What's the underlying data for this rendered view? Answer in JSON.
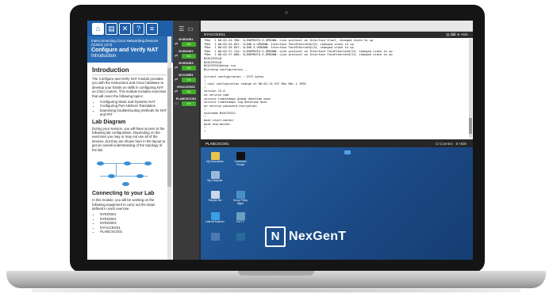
{
  "lab_panel": {
    "toolbar_icons": [
      "home-icon",
      "book-icon",
      "tools-icon",
      "help-icon",
      "document-icon"
    ],
    "course": "Interconnecting Cisco Networking Devices (ICND1 v3.0)",
    "lab_title": "Configure and Verify NAT",
    "lab_section": "Introduction",
    "intro_heading": "Introduction",
    "intro_text": "The Configure and Verify NAT module provides you with the instructions and Cisco hardware to develop your hands on skills in configuring NAT on Cisco routers. This module includes exercises that will cover the following topics:",
    "topics": [
      "Configuring Static and Dynamic NAT",
      "Configuring Port Address Translation",
      "Examining troubleshooting methods for NAT and PAT"
    ],
    "diagram_heading": "Lab Diagram",
    "diagram_text": "During your session, you will have access to the following lab configuration. Depending on the exercises you may or may not use all of the devices, but they are shown here in the layout to get an overall understanding of the topology of the lab.",
    "connect_heading": "Connecting to your Lab",
    "connect_text": "In this module, you will be working on the following equipment to carry out the steps defined in each exercise.",
    "equipment": [
      "NYEDGE1",
      "NYEDGE2",
      "NYEDGE3",
      "NYACCESS1",
      "PLABCSCO01"
    ]
  },
  "devices": [
    {
      "name": "NYEDGE1",
      "status": "On"
    },
    {
      "name": "NYEDGE2",
      "status": "On"
    },
    {
      "name": "NYEDGE3",
      "status": "On"
    },
    {
      "name": "NYCORE1",
      "status": "On"
    },
    {
      "name": "NYACCESS1",
      "status": "On"
    },
    {
      "name": "PLABCSCO01",
      "status": "On"
    }
  ],
  "terminal": {
    "title": "NYACCESS1",
    "hide_label": "Hide",
    "lines": [
      "*Mar  1 00:02:24.390: %LINEPROTO-5-UPDOWN: Line protocol on Interface Vlan1, changed state to up",
      "*Mar  1 00:02:25.857: %LINK-3-UPDOWN: Interface FastEthernet0/23, changed state to up",
      "*Mar  1 00:02:26.857: %LINK-3-UPDOWN: Interface FastEthernet0/24, changed state to up",
      "*Mar  1 00:02:27.134: %LINEPROTO-5-UPDOWN: Line protocol on Interface FastEthernet0/23, changed state to up",
      "*Mar  1 00:02:27.860: %LINEPROTO-5-UPDOWN: Line protocol on Interface FastEthernet0/24, changed state to up",
      "NYACCESS1#",
      "NYACCESS1#",
      "NYACCESS1#show run",
      "Building configuration...",
      "",
      "Current configuration : 1372 bytes",
      "!",
      "! Last configuration change at 00:01:14 UTC Mon Mar 1 1993",
      "!",
      "version 15.0",
      "no service pad",
      "service timestamps debug datetime msec",
      "service timestamps log datetime msec",
      "no service password-encryption",
      "!",
      "hostname NYACCESS1",
      "!",
      "boot-start-marker",
      "boot-end-marker",
      "!",
      "!"
    ]
  },
  "desktop": {
    "title": "PLABCSCO01",
    "connect_label": "Connect",
    "hide_label": "Hide",
    "icons": [
      {
        "label": "My Documents",
        "color": "#e8c44a"
      },
      {
        "label": "Command Prompt",
        "color": "#111111"
      },
      {
        "label": "My Computer",
        "color": "#9ab8d8"
      },
      {
        "label": "Recycle Bin",
        "color": "#c8d8e8"
      },
      {
        "label": "Group Policy Mgmt",
        "color": "#4a90c8"
      },
      {
        "label": "Internet Explorer",
        "color": "#3aa0e0"
      },
      {
        "label": "PuTTY",
        "color": "#6aa0c0"
      },
      {
        "label": "",
        "color": "#4a7ab0"
      },
      {
        "label": "",
        "color": "#2a6a9a"
      }
    ]
  },
  "brand": {
    "logo_text": "NexGenT",
    "mark": "N"
  }
}
